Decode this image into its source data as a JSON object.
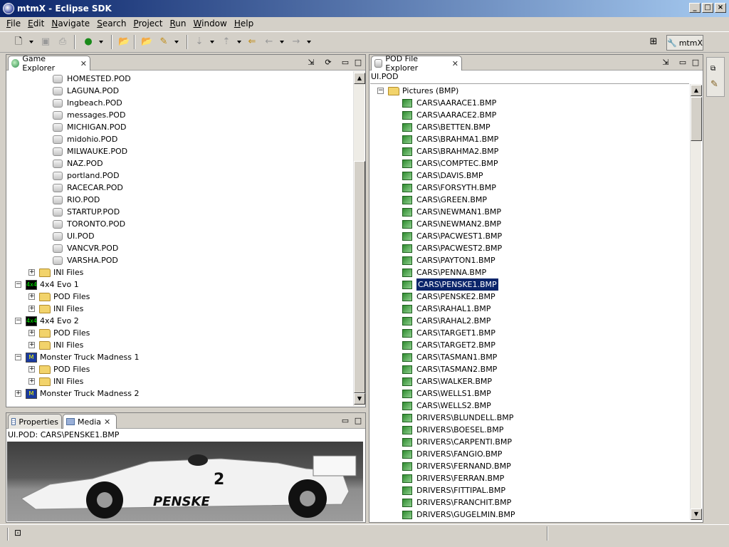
{
  "window": {
    "title": "mtmX - Eclipse SDK",
    "min": "_",
    "max": "□",
    "close": "×"
  },
  "menu": [
    "File",
    "Edit",
    "Navigate",
    "Search",
    "Project",
    "Run",
    "Window",
    "Help"
  ],
  "perspective": {
    "label": "mtmX"
  },
  "game_explorer": {
    "tab_label": "Game Explorer",
    "pod_files": [
      "HOMESTED.POD",
      "LAGUNA.POD",
      "lngbeach.POD",
      "messages.POD",
      "MICHIGAN.POD",
      "midohio.POD",
      "MILWAUKE.POD",
      "NAZ.POD",
      "portland.POD",
      "RACECAR.POD",
      "RIO.POD",
      "STARTUP.POD",
      "TORONTO.POD",
      "UI.POD",
      "VANCVR.POD",
      "VARSHA.POD"
    ],
    "ini_files_label": "INI Files",
    "pod_files_label": "POD Files",
    "games": [
      "4x4 Evo 1",
      "4x4 Evo 2",
      "Monster Truck Madness 1",
      "Monster Truck Madness 2"
    ]
  },
  "properties": {
    "tab_label": "Properties"
  },
  "media": {
    "tab_label": "Media",
    "caption": "UI.POD: CARS\\PENSKE1.BMP",
    "car_number": "2",
    "car_sponsor": "PENSKE"
  },
  "pod_explorer": {
    "tab_label": "POD File Explorer",
    "path": "UI.POD",
    "folder": "Pictures (BMP)",
    "selected": "CARS\\PENSKE1.BMP",
    "files": [
      "CARS\\AARACE1.BMP",
      "CARS\\AARACE2.BMP",
      "CARS\\BETTEN.BMP",
      "CARS\\BRAHMA1.BMP",
      "CARS\\BRAHMA2.BMP",
      "CARS\\COMPTEC.BMP",
      "CARS\\DAVIS.BMP",
      "CARS\\FORSYTH.BMP",
      "CARS\\GREEN.BMP",
      "CARS\\NEWMAN1.BMP",
      "CARS\\NEWMAN2.BMP",
      "CARS\\PACWEST1.BMP",
      "CARS\\PACWEST2.BMP",
      "CARS\\PAYTON1.BMP",
      "CARS\\PENNA.BMP",
      "CARS\\PENSKE1.BMP",
      "CARS\\PENSKE2.BMP",
      "CARS\\RAHAL1.BMP",
      "CARS\\RAHAL2.BMP",
      "CARS\\TARGET1.BMP",
      "CARS\\TARGET2.BMP",
      "CARS\\TASMAN1.BMP",
      "CARS\\TASMAN2.BMP",
      "CARS\\WALKER.BMP",
      "CARS\\WELLS1.BMP",
      "CARS\\WELLS2.BMP",
      "DRIVERS\\BLUNDELL.BMP",
      "DRIVERS\\BOESEL.BMP",
      "DRIVERS\\CARPENTI.BMP",
      "DRIVERS\\FANGIO.BMP",
      "DRIVERS\\FERNAND.BMP",
      "DRIVERS\\FERRAN.BMP",
      "DRIVERS\\FITTIPAL.BMP",
      "DRIVERS\\FRANCHIT.BMP",
      "DRIVERS\\GUGELMIN.BMP"
    ]
  },
  "colors": {
    "selection": "#0a246a",
    "title_start": "#0a246a",
    "title_end": "#a6caf0"
  }
}
